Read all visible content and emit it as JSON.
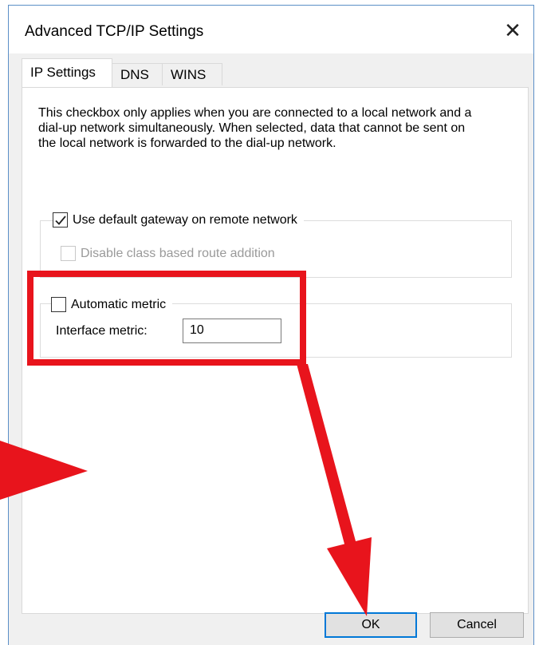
{
  "window": {
    "title": "Advanced TCP/IP Settings",
    "close_glyph": "✕"
  },
  "tabs": [
    {
      "label": "IP Settings",
      "active": true
    },
    {
      "label": "DNS",
      "active": false
    },
    {
      "label": "WINS",
      "active": false
    }
  ],
  "gateway_section": {
    "description": "This checkbox only applies when you are connected to a local network and a dial-up network simultaneously. When selected, data that cannot be sent on the local network is forwarded to the dial-up network.",
    "use_default_gateway": {
      "label": "Use default gateway on remote network",
      "checked": true
    },
    "disable_class_route": {
      "label": "Disable class based route addition",
      "checked": false,
      "enabled": false
    }
  },
  "metric_section": {
    "automatic_metric": {
      "label": "Automatic metric",
      "checked": false
    },
    "interface_metric_label": "Interface metric:",
    "interface_metric_value": "10"
  },
  "buttons": {
    "ok": "OK",
    "cancel": "Cancel"
  },
  "annotation_color": "#e8141c",
  "accent_color": "#0078d7"
}
